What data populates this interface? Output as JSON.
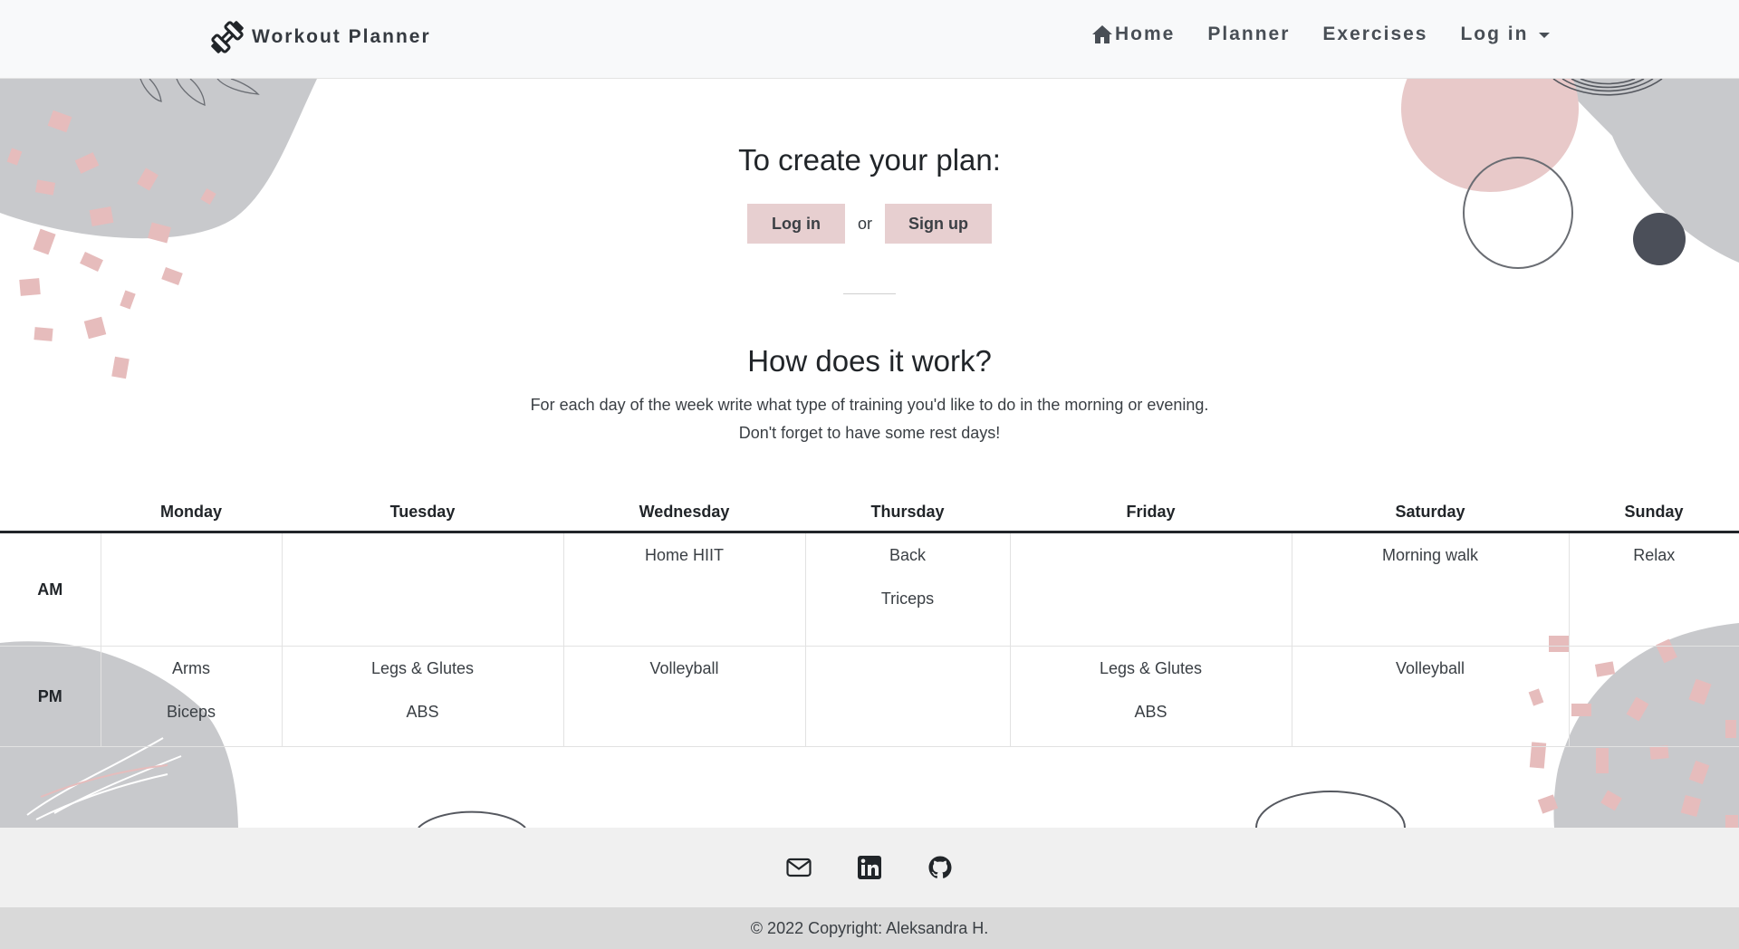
{
  "navbar": {
    "brand": "Workout Planner",
    "links": [
      {
        "label": "Home",
        "icon": "home-icon"
      },
      {
        "label": "Planner"
      },
      {
        "label": "Exercises"
      },
      {
        "label": "Log in",
        "icon": "caret-down-icon"
      }
    ]
  },
  "hero": {
    "title": "To create your plan:",
    "login_label": "Log in",
    "or_label": "or",
    "signup_label": "Sign up"
  },
  "how": {
    "title": "How does it work?",
    "line1": "For each day of the week write what type of training you'd like to do in the morning or evening.",
    "line2": "Don't forget to have some rest days!"
  },
  "schedule": {
    "days": [
      "Monday",
      "Tuesday",
      "Wednesday",
      "Thursday",
      "Friday",
      "Saturday",
      "Sunday"
    ],
    "rows": [
      {
        "label": "AM",
        "cells": [
          [],
          [],
          [
            "Home HIIT"
          ],
          [
            "Back",
            "Triceps"
          ],
          [],
          [
            "Morning walk"
          ],
          [
            "Relax"
          ]
        ]
      },
      {
        "label": "PM",
        "cells": [
          [
            "Arms",
            "Biceps"
          ],
          [
            "Legs & Glutes",
            "ABS"
          ],
          [
            "Volleyball"
          ],
          [],
          [
            "Legs & Glutes",
            "ABS"
          ],
          [
            "Volleyball"
          ],
          []
        ]
      }
    ]
  },
  "footer": {
    "icons": [
      "mail-icon",
      "linkedin-icon",
      "github-icon"
    ],
    "copyright": "© 2022 Copyright: Aleksandra H."
  },
  "colors": {
    "accent": "#e7cfd0",
    "navbar_bg": "#f8f9fa",
    "blob_gray": "#c8c9cc",
    "blob_pink": "#e8c9c9",
    "dark_dot": "#4b4f59"
  }
}
